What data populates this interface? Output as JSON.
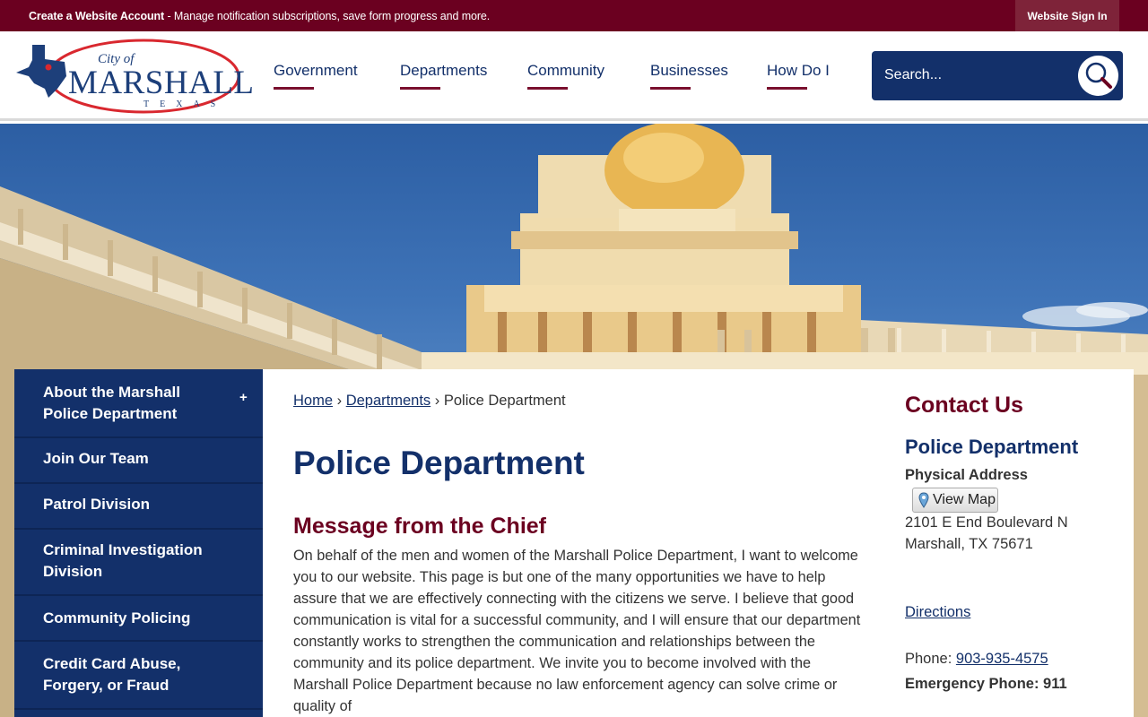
{
  "topbar": {
    "account_link": "Create a Website Account",
    "account_text": " - Manage notification subscriptions, save form progress and more.",
    "signin": "Website Sign In"
  },
  "logo": {
    "city_of": "City of",
    "name": "MARSHALL",
    "state": "TEXAS"
  },
  "nav": {
    "items": [
      "Government",
      "Departments",
      "Community",
      "Businesses",
      "How Do I"
    ]
  },
  "search": {
    "placeholder": "Search..."
  },
  "sidebar": {
    "items": [
      {
        "label": "About the Marshall Police Department",
        "expandable": true
      },
      {
        "label": "Join Our Team"
      },
      {
        "label": "Patrol Division"
      },
      {
        "label": "Criminal Investigation Division"
      },
      {
        "label": "Community Policing"
      },
      {
        "label": "Credit Card Abuse, Forgery, or Fraud"
      }
    ],
    "expand_symbol": "+"
  },
  "breadcrumb": {
    "home": "Home",
    "departments": "Departments",
    "current": "Police Department",
    "separator": "›"
  },
  "main": {
    "title": "Police Department",
    "message_title": "Message from the Chief",
    "message_body": "On behalf of the men and women of the Marshall Police Department, I want to welcome you to our website. This page is but one of the many opportunities we have to help assure that we are effectively connecting with the citizens we serve. I believe that good communication is vital for a successful community, and I will ensure that our department constantly works to strengthen the communication and relationships between the community and its police department. We invite you to become involved with the Marshall Police Department because no law enforcement agency can solve crime or quality of"
  },
  "contact": {
    "title": "Contact Us",
    "department": "Police Department",
    "address_label": "Physical Address",
    "view_map": "View Map",
    "address_line1": "2101 E End Boulevard N",
    "address_line2": "Marshall, TX 75671",
    "directions": "Directions",
    "phone_label": "Phone: ",
    "phone": "903-935-4575",
    "emergency": "Emergency Phone: 911"
  },
  "colors": {
    "maroon": "#6b0020",
    "navy": "#13306a"
  }
}
